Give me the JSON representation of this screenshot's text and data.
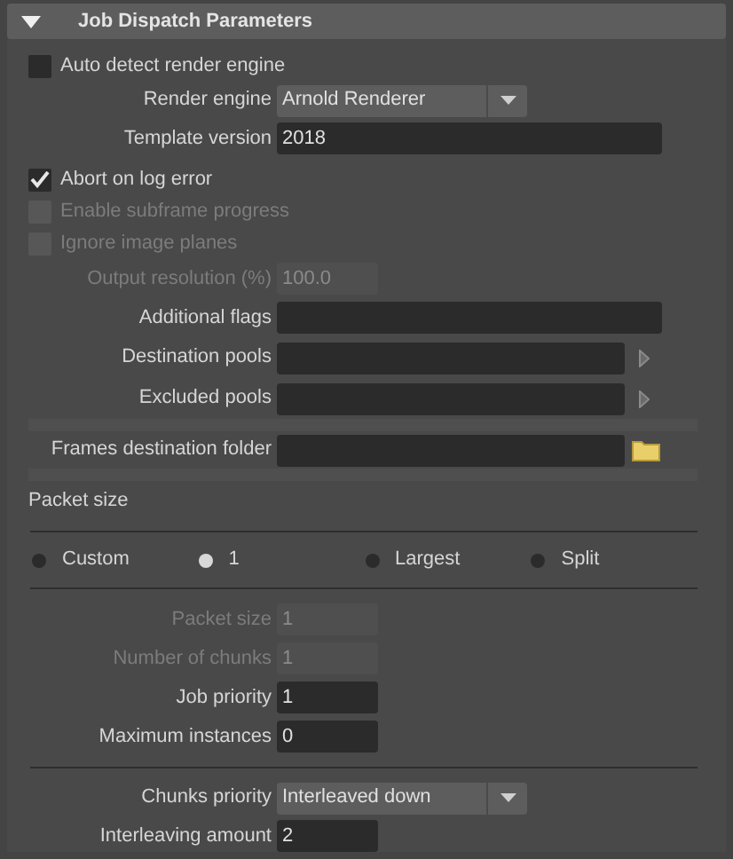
{
  "section": {
    "title": "Job Dispatch Parameters",
    "expanded": true
  },
  "rows": [
    {
      "kind": "checkbox",
      "label": "Auto detect render engine",
      "checked": false,
      "disabled": false
    },
    {
      "kind": "dropdown",
      "label": "Render engine",
      "value": "Arnold Renderer"
    },
    {
      "kind": "text-field",
      "label": "Template version",
      "value": "2018"
    },
    {
      "kind": "checkbox",
      "label": "Abort on log error",
      "checked": true,
      "disabled": false
    },
    {
      "kind": "checkbox",
      "label": "Enable subframe progress",
      "checked": false,
      "disabled": true
    },
    {
      "kind": "checkbox",
      "label": "Ignore image planes",
      "checked": false,
      "disabled": true
    },
    {
      "kind": "number-field",
      "label": "Output resolution (%)",
      "value": "100.0",
      "disabled": true
    },
    {
      "kind": "text-field",
      "label": "Additional flags"
    },
    {
      "kind": "pool",
      "label": "Destination pools"
    },
    {
      "kind": "pool",
      "label": "Excluded pools"
    },
    {
      "kind": "gap"
    },
    {
      "kind": "folder",
      "label": "Frames destination folder"
    },
    {
      "kind": "gap"
    },
    {
      "kind": "heading",
      "label": "Packet size"
    },
    {
      "kind": "divider"
    },
    {
      "kind": "radios",
      "options": [
        {
          "label": "Custom",
          "selected": false
        },
        {
          "label": "1",
          "selected": true
        },
        {
          "label": "Largest",
          "selected": false
        },
        {
          "label": "Split",
          "selected": false
        }
      ]
    },
    {
      "kind": "divider"
    },
    {
      "kind": "number-field",
      "label": "Packet size",
      "value": "1",
      "disabled": true
    },
    {
      "kind": "number-field",
      "label": "Number of chunks",
      "value": "1",
      "disabled": true
    },
    {
      "kind": "number-field",
      "label": "Job priority",
      "value": "1",
      "disabled": false
    },
    {
      "kind": "number-field",
      "label": "Maximum instances",
      "value": "0",
      "disabled": false
    },
    {
      "kind": "divider"
    },
    {
      "kind": "dropdown",
      "label": "Chunks priority",
      "value": "Interleaved down"
    },
    {
      "kind": "number-field",
      "label": "Interleaving amount",
      "value": "2",
      "disabled": false
    }
  ]
}
